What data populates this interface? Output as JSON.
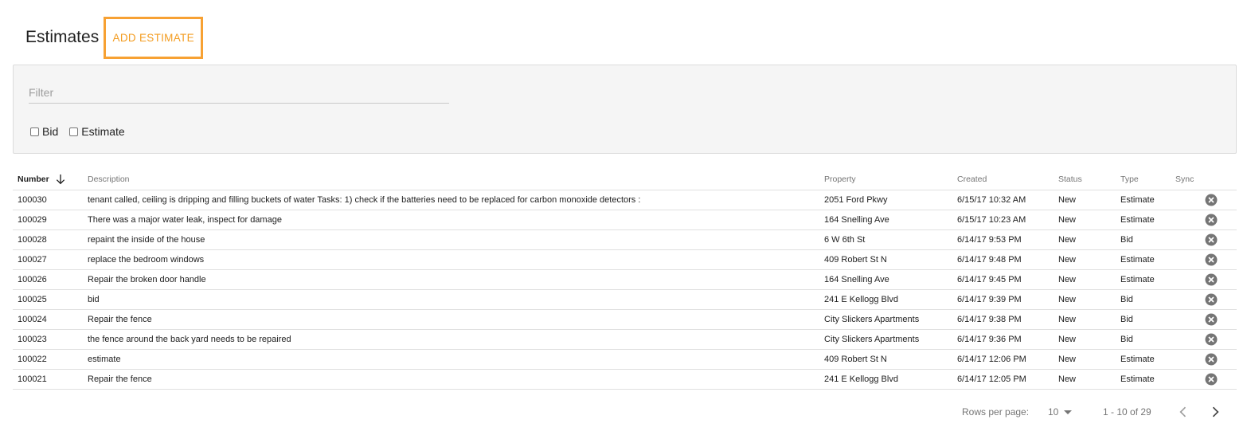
{
  "header": {
    "title": "Estimates",
    "add_button": "ADD ESTIMATE"
  },
  "filter": {
    "placeholder": "Filter",
    "value": "",
    "checkboxes": [
      {
        "label": "Bid",
        "checked": false
      },
      {
        "label": "Estimate",
        "checked": false
      }
    ]
  },
  "table": {
    "columns": {
      "number": "Number",
      "description": "Description",
      "property": "Property",
      "created": "Created",
      "status": "Status",
      "type": "Type",
      "sync": "Sync"
    },
    "sort": {
      "column": "Number",
      "direction": "descending"
    },
    "rows": [
      {
        "number": "100030",
        "description": "tenant called, ceiling is dripping and filling buckets of water Tasks: 1) check if the batteries need to be replaced for carbon monoxide detectors :",
        "property": "2051 Ford Pkwy",
        "created": "6/15/17 10:32 AM",
        "status": "New",
        "type": "Estimate"
      },
      {
        "number": "100029",
        "description": "There was a major water leak, inspect for damage",
        "property": "164 Snelling Ave",
        "created": "6/15/17 10:23 AM",
        "status": "New",
        "type": "Estimate"
      },
      {
        "number": "100028",
        "description": "repaint the inside of the house",
        "property": "6 W 6th St",
        "created": "6/14/17 9:53 PM",
        "status": "New",
        "type": "Bid"
      },
      {
        "number": "100027",
        "description": "replace the bedroom windows",
        "property": "409 Robert St N",
        "created": "6/14/17 9:48 PM",
        "status": "New",
        "type": "Estimate"
      },
      {
        "number": "100026",
        "description": "Repair the broken door handle",
        "property": "164 Snelling Ave",
        "created": "6/14/17 9:45 PM",
        "status": "New",
        "type": "Estimate"
      },
      {
        "number": "100025",
        "description": "bid",
        "property": "241 E Kellogg Blvd",
        "created": "6/14/17 9:39 PM",
        "status": "New",
        "type": "Bid"
      },
      {
        "number": "100024",
        "description": "Repair the fence",
        "property": "City Slickers Apartments",
        "created": "6/14/17 9:38 PM",
        "status": "New",
        "type": "Bid"
      },
      {
        "number": "100023",
        "description": "the fence around the back yard needs to be repaired",
        "property": "City Slickers Apartments",
        "created": "6/14/17 9:36 PM",
        "status": "New",
        "type": "Bid"
      },
      {
        "number": "100022",
        "description": "estimate",
        "property": "409 Robert St N",
        "created": "6/14/17 12:06 PM",
        "status": "New",
        "type": "Estimate"
      },
      {
        "number": "100021",
        "description": "Repair the fence",
        "property": "241 E Kellogg Blvd",
        "created": "6/14/17 12:05 PM",
        "status": "New",
        "type": "Estimate"
      }
    ],
    "sync_icon": "cancel-circle-icon"
  },
  "pagination": {
    "rows_per_page_label": "Rows per page:",
    "rows_per_page": "10",
    "range": "1 - 10 of 29"
  },
  "colors": {
    "accent": "#f7a133",
    "accent_text": "#f39c20",
    "panel_bg": "#f5f5f5",
    "icon": "#757575"
  }
}
